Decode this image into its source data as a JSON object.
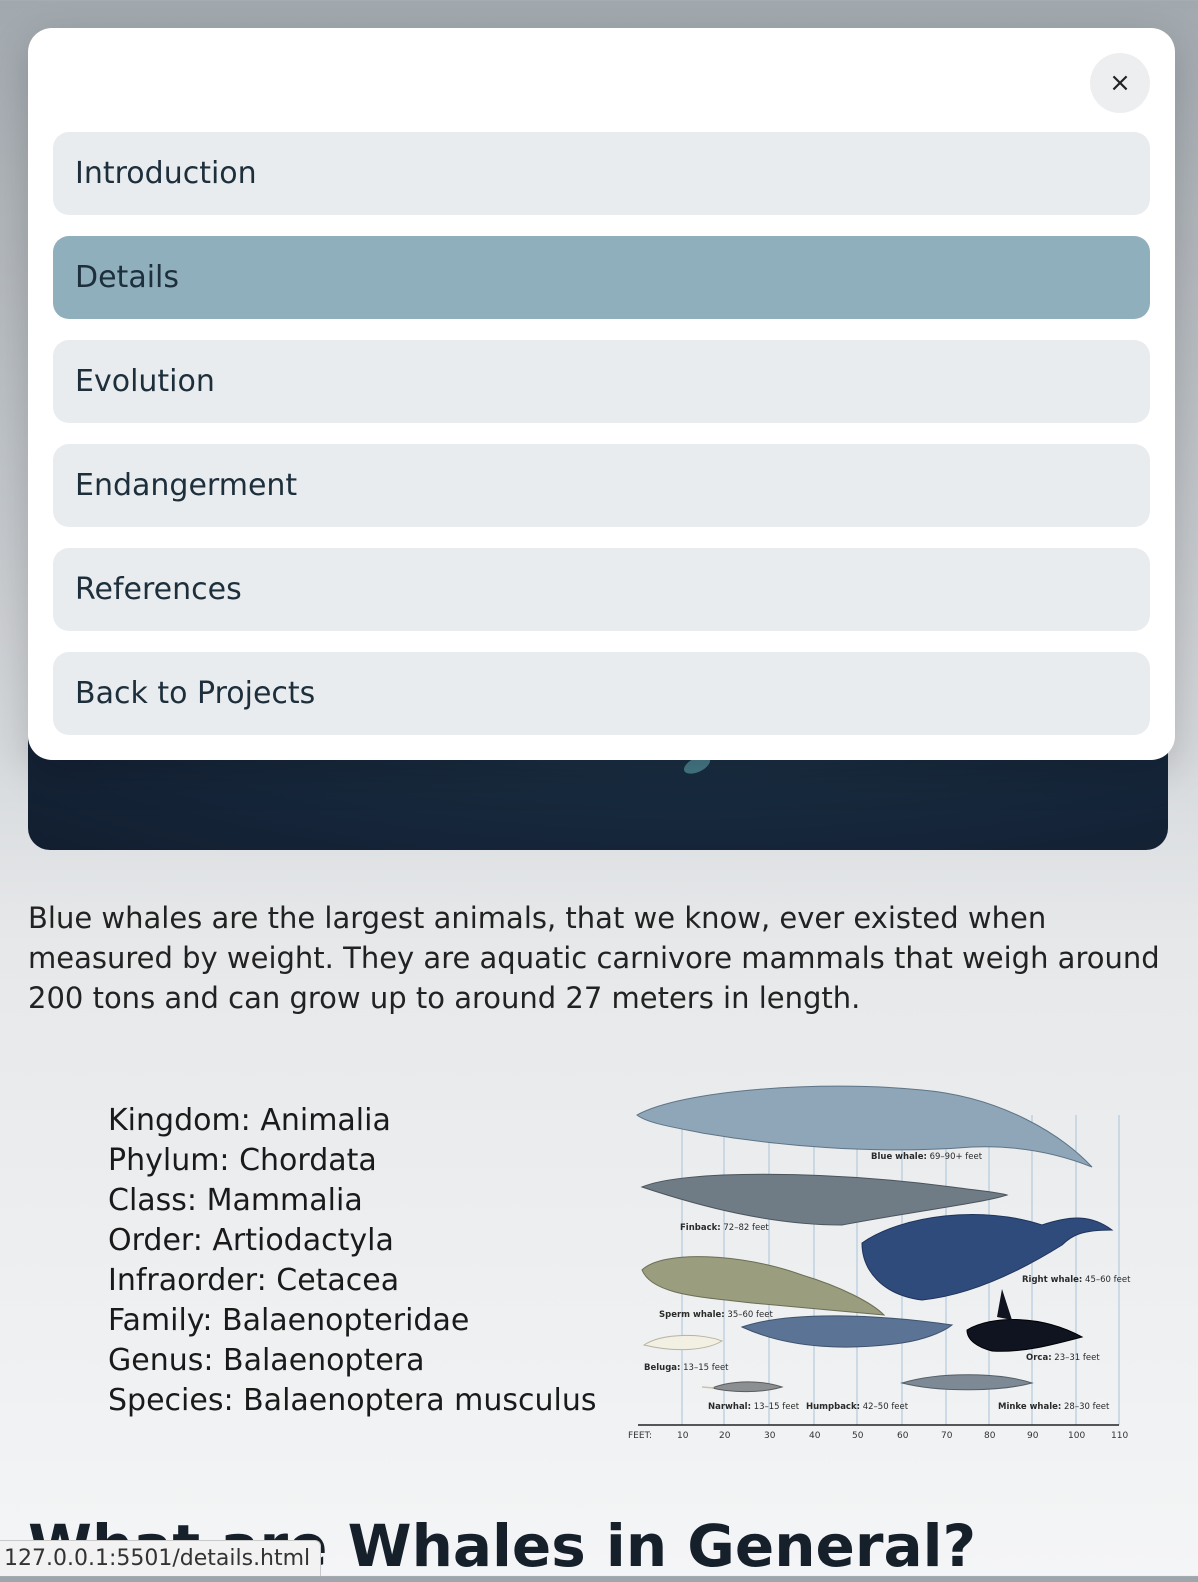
{
  "menu": {
    "close_label": "×",
    "items": [
      {
        "label": "Introduction",
        "active": false
      },
      {
        "label": "Details",
        "active": true
      },
      {
        "label": "Evolution",
        "active": false
      },
      {
        "label": "Endangerment",
        "active": false
      },
      {
        "label": "References",
        "active": false
      },
      {
        "label": "Back to Projects",
        "active": false
      }
    ]
  },
  "content": {
    "intro": "Blue whales are the largest animals, that we know, ever existed when measured by weight. They are aquatic carnivore mammals that weigh around 200 tons and can grow up to around 27 meters in length.",
    "taxonomy": [
      "Kingdom: Animalia",
      "Phylum: Chordata",
      "Class: Mammalia",
      "Order: Artiodactyla",
      "Infraorder: Cetacea",
      "Family: Balaenopteridae",
      "Genus: Balaenoptera",
      "Species: Balaenoptera musculus"
    ],
    "size_chart": {
      "axis_unit": "FEET:",
      "ticks": [
        "10",
        "20",
        "30",
        "40",
        "50",
        "60",
        "70",
        "80",
        "90",
        "100",
        "110"
      ],
      "labels": {
        "blue": {
          "name": "Blue whale:",
          "size": "69–90+ feet"
        },
        "finback": {
          "name": "Finback:",
          "size": "72–82 feet"
        },
        "right": {
          "name": "Right whale:",
          "size": "45–60 feet"
        },
        "sperm": {
          "name": "Sperm whale:",
          "size": "35–60 feet"
        },
        "beluga": {
          "name": "Beluga:",
          "size": "13–15 feet"
        },
        "orca": {
          "name": "Orca:",
          "size": "23–31 feet"
        },
        "narwhal": {
          "name": "Narwhal:",
          "size": "13–15 feet"
        },
        "humpback": {
          "name": "Humpback:",
          "size": "42–50 feet"
        },
        "minke": {
          "name": "Minke whale:",
          "size": "28–30 feet"
        }
      }
    },
    "heading": "What are Whales in General?"
  },
  "browser": {
    "status_url": "127.0.0.1:5501/details.html"
  }
}
